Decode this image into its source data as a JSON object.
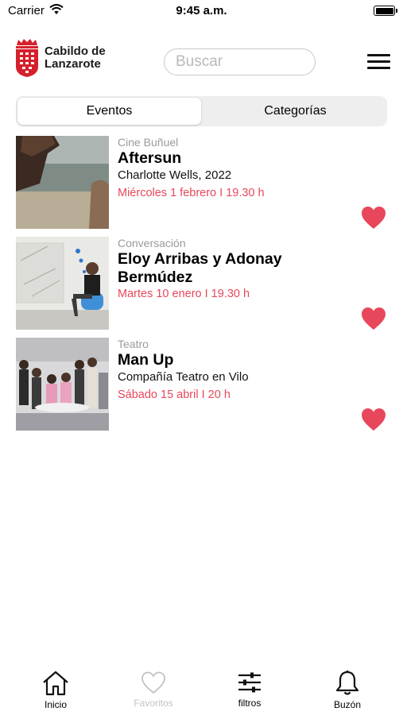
{
  "status_bar": {
    "carrier": "Carrier",
    "time": "9:45 a.m."
  },
  "header": {
    "logo_line1": "Cabildo de",
    "logo_line2": "Lanzarote",
    "search_placeholder": "Buscar"
  },
  "tabs_top": {
    "active": "Eventos",
    "inactive": "Categorías"
  },
  "events": [
    {
      "category": "Cine Buñuel",
      "title": "Aftersun",
      "subtitle": "Charlotte Wells, 2022",
      "date": "Miércoles 1 febrero I 19.30 h",
      "favorite": true
    },
    {
      "category": "Conversación",
      "title": "Eloy Arribas y Adonay Bermúdez",
      "subtitle": "",
      "date": "Martes 10 enero I 19.30 h",
      "favorite": true
    },
    {
      "category": "Teatro",
      "title": "Man Up",
      "subtitle": "Compañía Teatro en Vilo",
      "date": "Sábado 15 abril I 20 h",
      "favorite": true
    }
  ],
  "tab_bar": {
    "items": [
      {
        "label": "Inicio",
        "icon": "home-icon"
      },
      {
        "label": "Favoritos",
        "icon": "heart-outline-icon"
      },
      {
        "label": "filtros",
        "icon": "sliders-icon"
      },
      {
        "label": "Buzón",
        "icon": "bell-icon"
      }
    ]
  },
  "colors": {
    "accent_red": "#e8475b",
    "logo_red": "#d6202c",
    "disabled_gray": "#c2c2c2"
  }
}
